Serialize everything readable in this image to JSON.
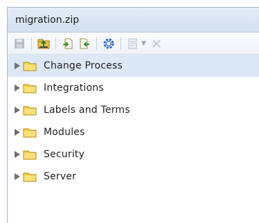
{
  "window": {
    "title": "migration.zip"
  },
  "toolbar": {
    "buttons": [
      {
        "icon": "save-icon",
        "enabled": false
      },
      {
        "icon": "folder-export-icon",
        "enabled": true
      },
      {
        "icon": "page-import-icon",
        "enabled": true
      },
      {
        "icon": "page-export-icon",
        "enabled": true
      },
      {
        "icon": "settings-gear-icon",
        "enabled": true
      },
      {
        "icon": "document-menu-icon",
        "enabled": false
      },
      {
        "icon": "close-icon",
        "enabled": false
      }
    ]
  },
  "tree": {
    "items": [
      {
        "label": "Change Process",
        "selected": true
      },
      {
        "label": "Integrations",
        "selected": false
      },
      {
        "label": "Labels and Terms",
        "selected": false
      },
      {
        "label": "Modules",
        "selected": false
      },
      {
        "label": "Security",
        "selected": false
      },
      {
        "label": "Server",
        "selected": false
      }
    ]
  },
  "colors": {
    "title_bg": "#d3e0f0",
    "selected_row_bg": "#dde8f6",
    "folder_yellow": "#f5cf4a",
    "expander_gray": "#707070",
    "gear_blue": "#2a63c8"
  }
}
